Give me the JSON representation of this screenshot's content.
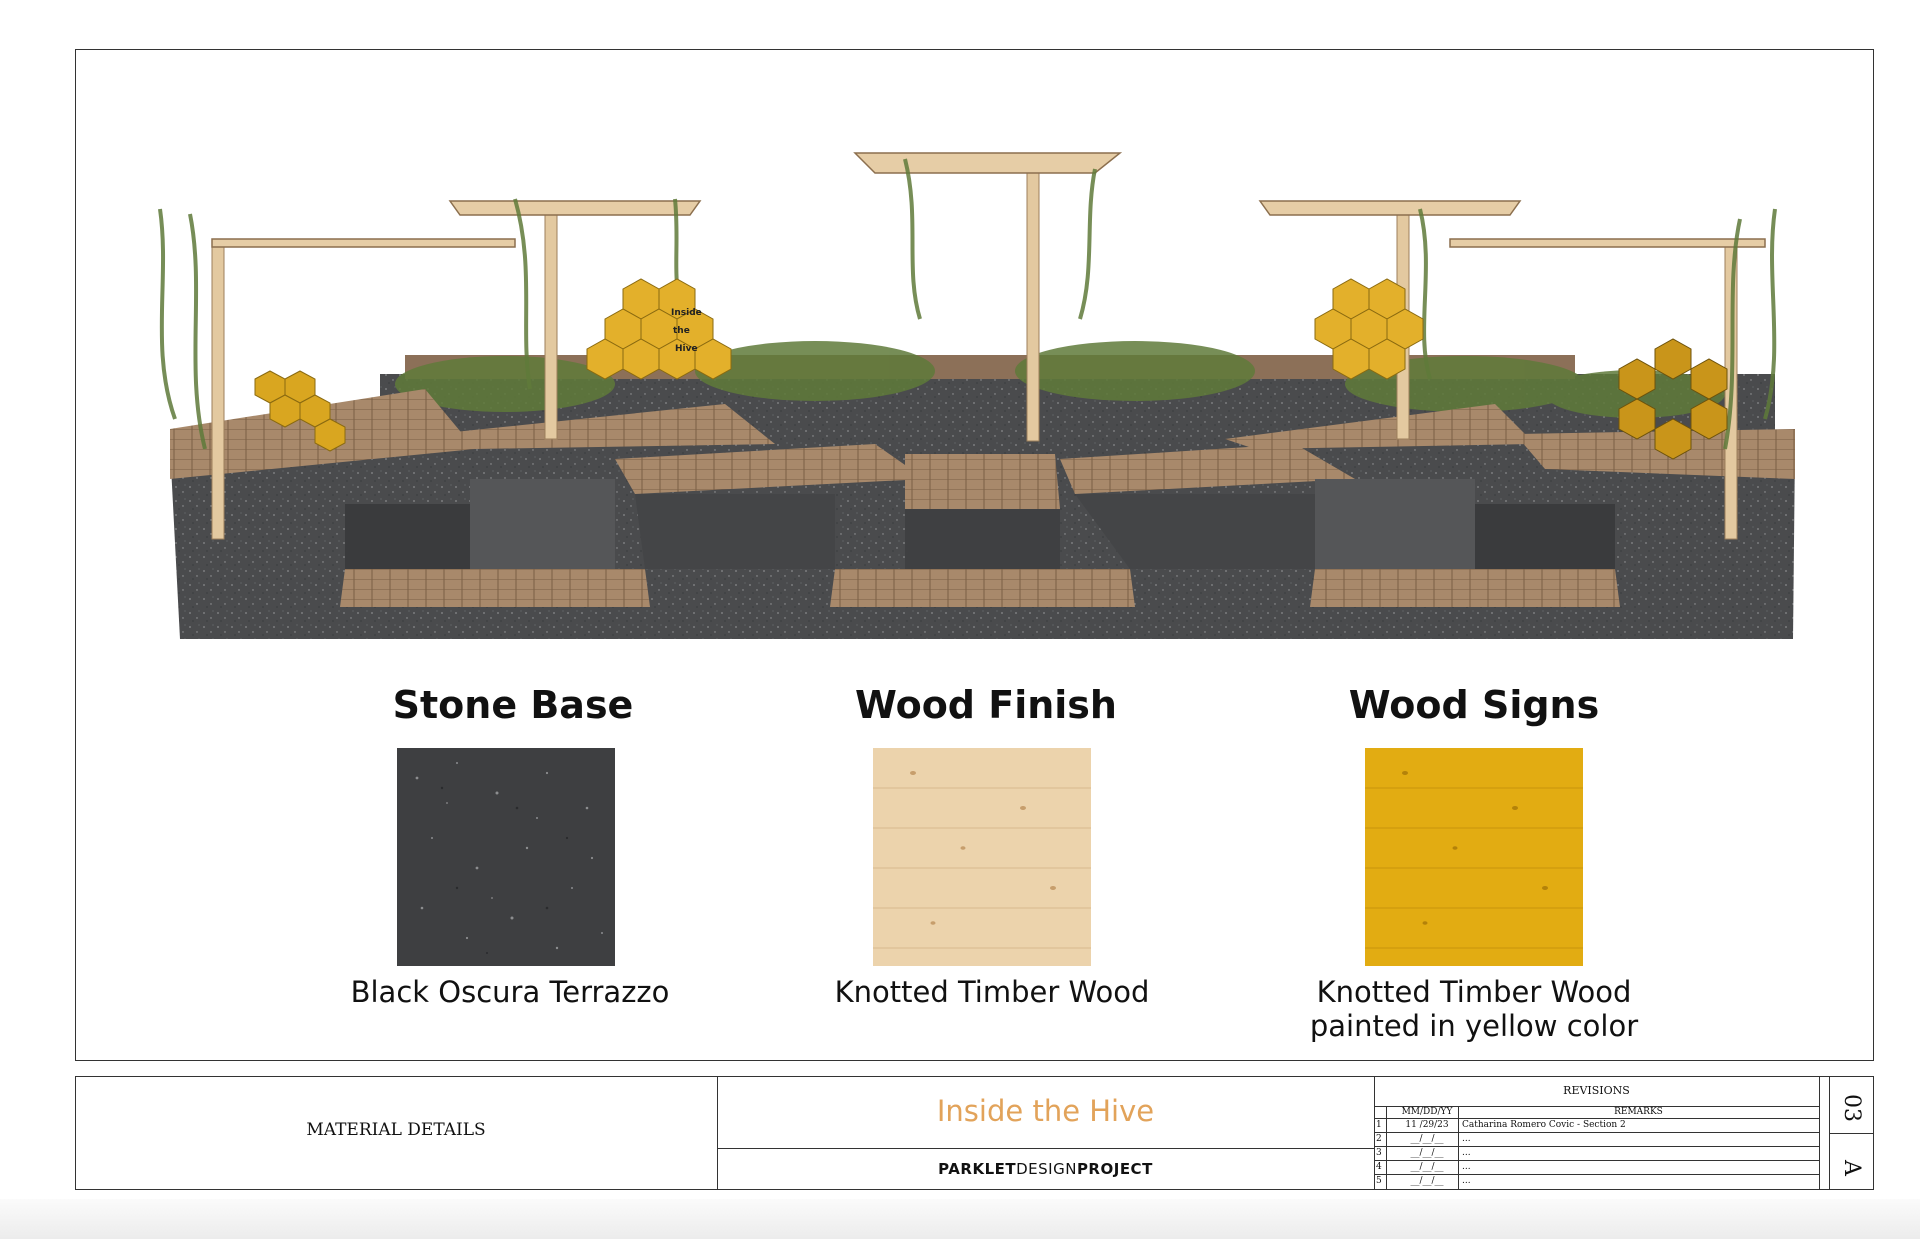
{
  "materials": [
    {
      "title": "Stone Base",
      "caption": "Black Oscura Terrazzo"
    },
    {
      "title": "Wood Finish",
      "caption": "Knotted Timber Wood"
    },
    {
      "title": "Wood Signs",
      "caption_line1": "Knotted Timber Wood",
      "caption_line2": "painted in yellow color"
    }
  ],
  "sign_text": {
    "line1": "Inside",
    "line2": "the",
    "line3": "Hive"
  },
  "title_block": {
    "sheet_label": "MATERIAL DETAILS",
    "project_title": "Inside the Hive",
    "brand_a": "PARKLET",
    "brand_b": "DESIGN",
    "brand_c": "PROJECT",
    "revisions_heading": "REVISIONS",
    "col_date": "MM/DD/YY",
    "col_remarks": "REMARKS",
    "rows": [
      {
        "num": "1",
        "date": "11 /29/23",
        "remark": "Catharina Romero Covic - Section 2"
      },
      {
        "num": "2",
        "date": "__/__/__",
        "remark": "..."
      },
      {
        "num": "3",
        "date": "__/__/__",
        "remark": "..."
      },
      {
        "num": "4",
        "date": "__/__/__",
        "remark": "..."
      },
      {
        "num": "5",
        "date": "__/__/__",
        "remark": "..."
      }
    ],
    "sheet_number": "03",
    "sheet_letter": "A"
  },
  "colors": {
    "stone": "#4b4c4e",
    "wood": "#a58466",
    "timber": "#e9cfa6",
    "sign_yellow": "#e0ac1c",
    "title_orange": "#e2a35a",
    "foliage": "#5f7a3a"
  }
}
